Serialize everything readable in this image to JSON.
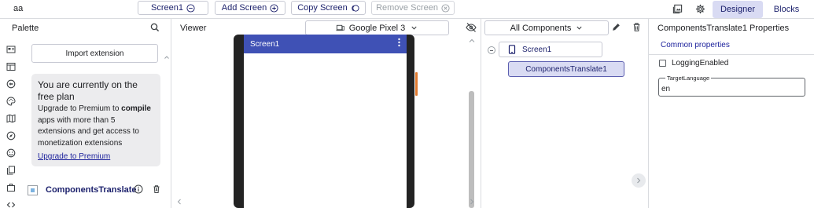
{
  "topbar": {
    "project_name": "aa",
    "screen_select": "Screen1",
    "add_screen": "Add Screen",
    "copy_screen": "Copy Screen",
    "remove_screen": "Remove Screen",
    "designer": "Designer",
    "blocks": "Blocks"
  },
  "palette": {
    "title": "Palette",
    "import_extension": "Import extension",
    "plan_card": {
      "title": "You are currently on the free plan",
      "body_before": "Upgrade to Premium to ",
      "body_bold": "compile",
      "body_after": " apps with more than 5 extensions and get access to monetization extensions",
      "link": "Upgrade to Premium"
    },
    "extension_label": "ComponentsTranslate"
  },
  "viewer": {
    "title": "Viewer",
    "device": "Google Pixel 3",
    "screen_title": "Screen1"
  },
  "components": {
    "filter": "All Components",
    "tree_root": "Screen1",
    "tree_child": "ComponentsTranslate1"
  },
  "properties": {
    "title": "ComponentsTranslate1 Properties",
    "section": "Common properties",
    "logging_label": "LoggingEnabled",
    "logging_checked": false,
    "target_language_label": "TargetLanguage",
    "target_language_value": "en"
  },
  "colors": {
    "accent": "#1a1f6b",
    "active_tab": "#d9dbf3",
    "phone_appbar": "#3f51b5",
    "link": "#1a1f9b"
  },
  "icons": {
    "palette_categories": [
      "layout-icon",
      "table-icon",
      "media-icon",
      "palette-icon",
      "map-icon",
      "sensor-icon",
      "social-icon",
      "storage-icon",
      "connectivity-icon",
      "code-icon"
    ]
  }
}
